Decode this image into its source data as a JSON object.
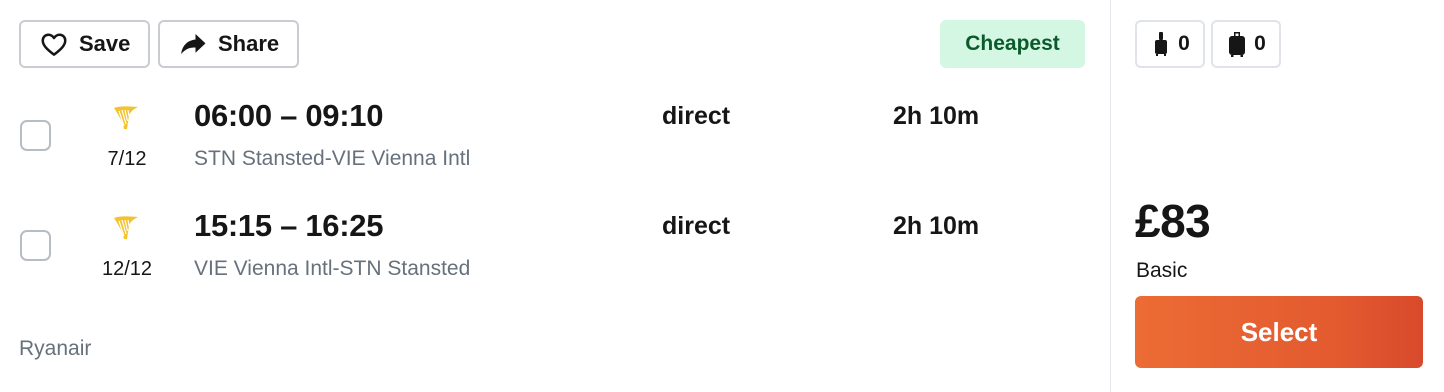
{
  "actions": {
    "save_label": "Save",
    "share_label": "Share"
  },
  "badge": {
    "label": "Cheapest",
    "bg": "#d4f7e3",
    "fg": "#0a5a2c"
  },
  "flights": [
    {
      "date": "7/12",
      "times": "06:00 – 09:10",
      "route": "STN Stansted-VIE Vienna Intl",
      "stops": "direct",
      "duration": "2h 10m",
      "logo": "ryanair-harp-icon"
    },
    {
      "date": "12/12",
      "times": "15:15 – 16:25",
      "route": "VIE Vienna Intl-STN Stansted",
      "stops": "direct",
      "duration": "2h 10m",
      "logo": "ryanair-harp-icon"
    }
  ],
  "carrier": "Ryanair",
  "bags": {
    "cabin_count": "0",
    "checked_count": "0"
  },
  "price": {
    "amount": "£83",
    "fare_type": "Basic"
  },
  "select_label": "Select",
  "colors": {
    "accent": "#e35a2f",
    "logo_yellow": "#f2c230",
    "muted": "#66717c"
  }
}
